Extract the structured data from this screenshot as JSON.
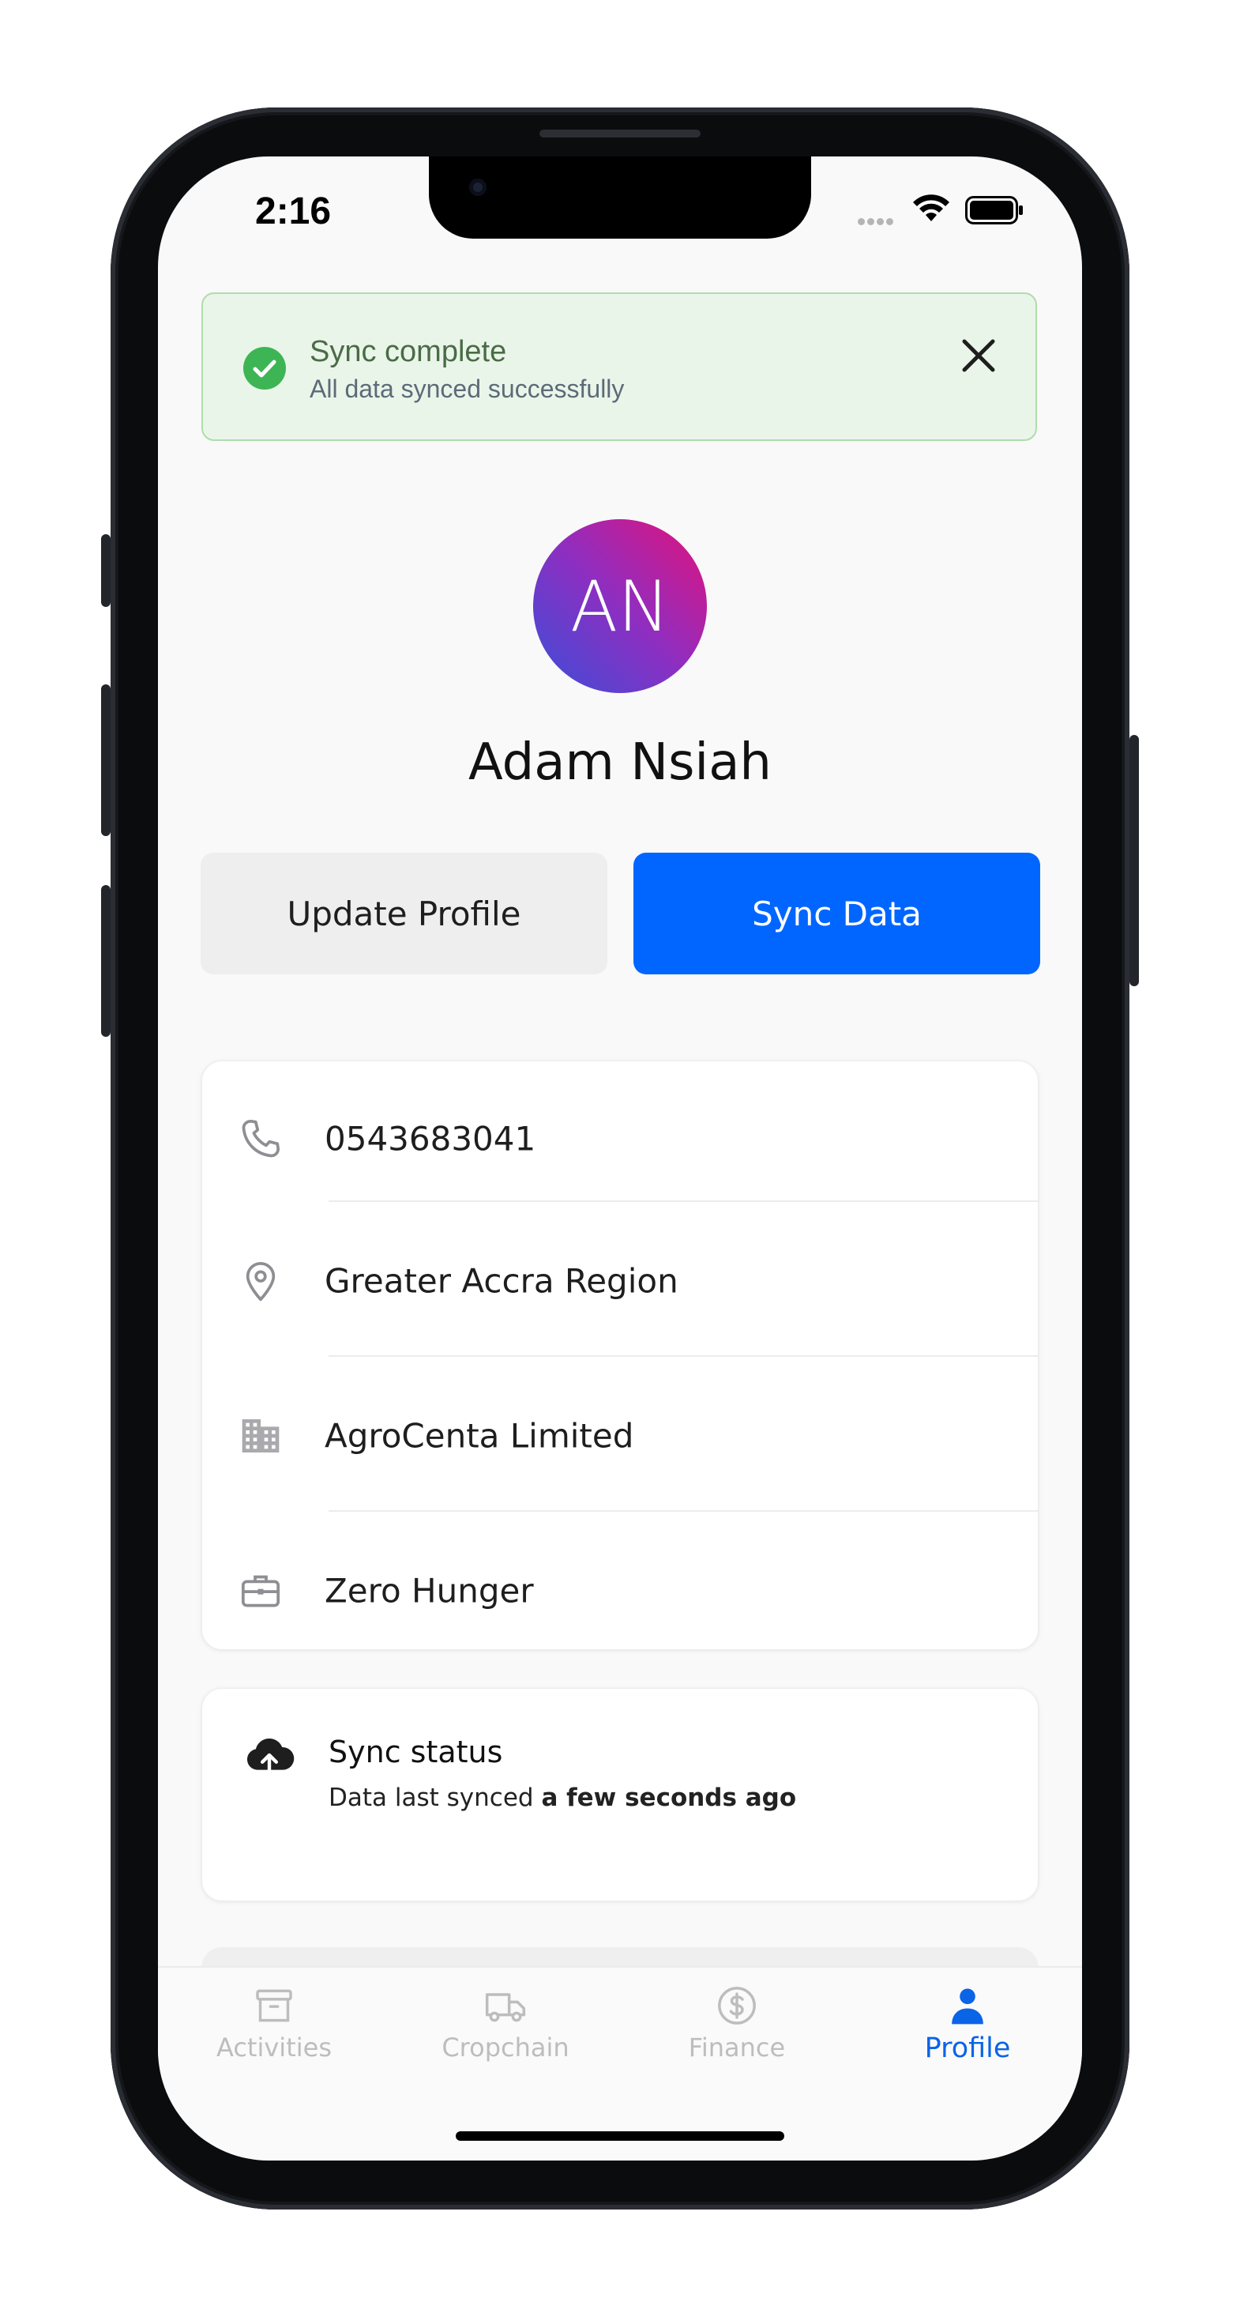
{
  "status_bar": {
    "time": "2:16"
  },
  "toast": {
    "title": "Sync complete",
    "message": "All data synced successfully",
    "success_color": "#3db555"
  },
  "profile": {
    "initials": "AN",
    "name": "Adam Nsiah",
    "avatar_gradient": [
      "#e3127a",
      "#3a4fd8"
    ]
  },
  "actions": {
    "update_label": "Update Profile",
    "sync_label": "Sync Data",
    "accent": "#0066ff"
  },
  "info": [
    {
      "icon": "phone-icon",
      "text": "0543683041"
    },
    {
      "icon": "location-pin-icon",
      "text": "Greater Accra Region"
    },
    {
      "icon": "building-icon",
      "text": "AgroCenta Limited"
    },
    {
      "icon": "briefcase-icon",
      "text": "Zero Hunger"
    }
  ],
  "sync_status": {
    "title": "Sync status",
    "prefix": "Data last synced ",
    "when": "a few seconds ago"
  },
  "tabs": [
    {
      "label": "Activities",
      "icon": "archive-box-icon",
      "active": false
    },
    {
      "label": "Cropchain",
      "icon": "truck-icon",
      "active": false
    },
    {
      "label": "Finance",
      "icon": "dollar-circle-icon",
      "active": false
    },
    {
      "label": "Profile",
      "icon": "person-icon",
      "active": true
    }
  ]
}
